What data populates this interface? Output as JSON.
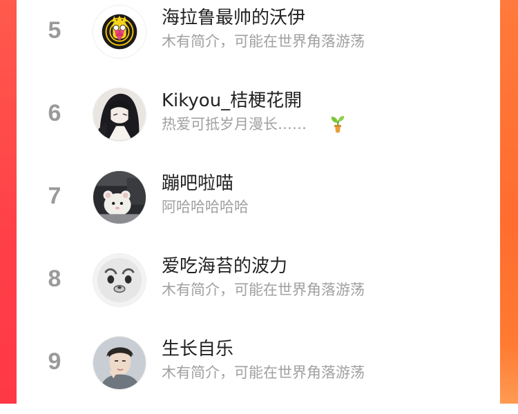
{
  "ranking": {
    "rows": [
      {
        "rank": "5",
        "name": "海拉鲁最帅的沃伊",
        "bio": "木有简介，可能在世界角落游荡",
        "avatar": "cartoon-avatar"
      },
      {
        "rank": "6",
        "name": "Kikyou_桔梗花開",
        "bio": "热爱可抵岁月漫长……",
        "avatar": "anime-girl-avatar",
        "badge_icon": "sprout-icon"
      },
      {
        "rank": "7",
        "name": "蹦吧啦喵",
        "bio": "阿哈哈哈哈哈",
        "avatar": "white-mouse-avatar"
      },
      {
        "rank": "8",
        "name": "爱吃海苔的波力",
        "bio": "木有简介，可能在世界角落游荡",
        "avatar": "pixel-face-avatar"
      },
      {
        "rank": "9",
        "name": "生长自乐",
        "bio": "木有简介，可能在世界角落游荡",
        "avatar": "portrait-avatar"
      }
    ]
  },
  "colors": {
    "accent_left": "#ff4048",
    "accent_right": "#ff7032",
    "rank_text": "#9a9a9a",
    "name_text": "#222222",
    "bio_text": "#a0a0a0"
  }
}
